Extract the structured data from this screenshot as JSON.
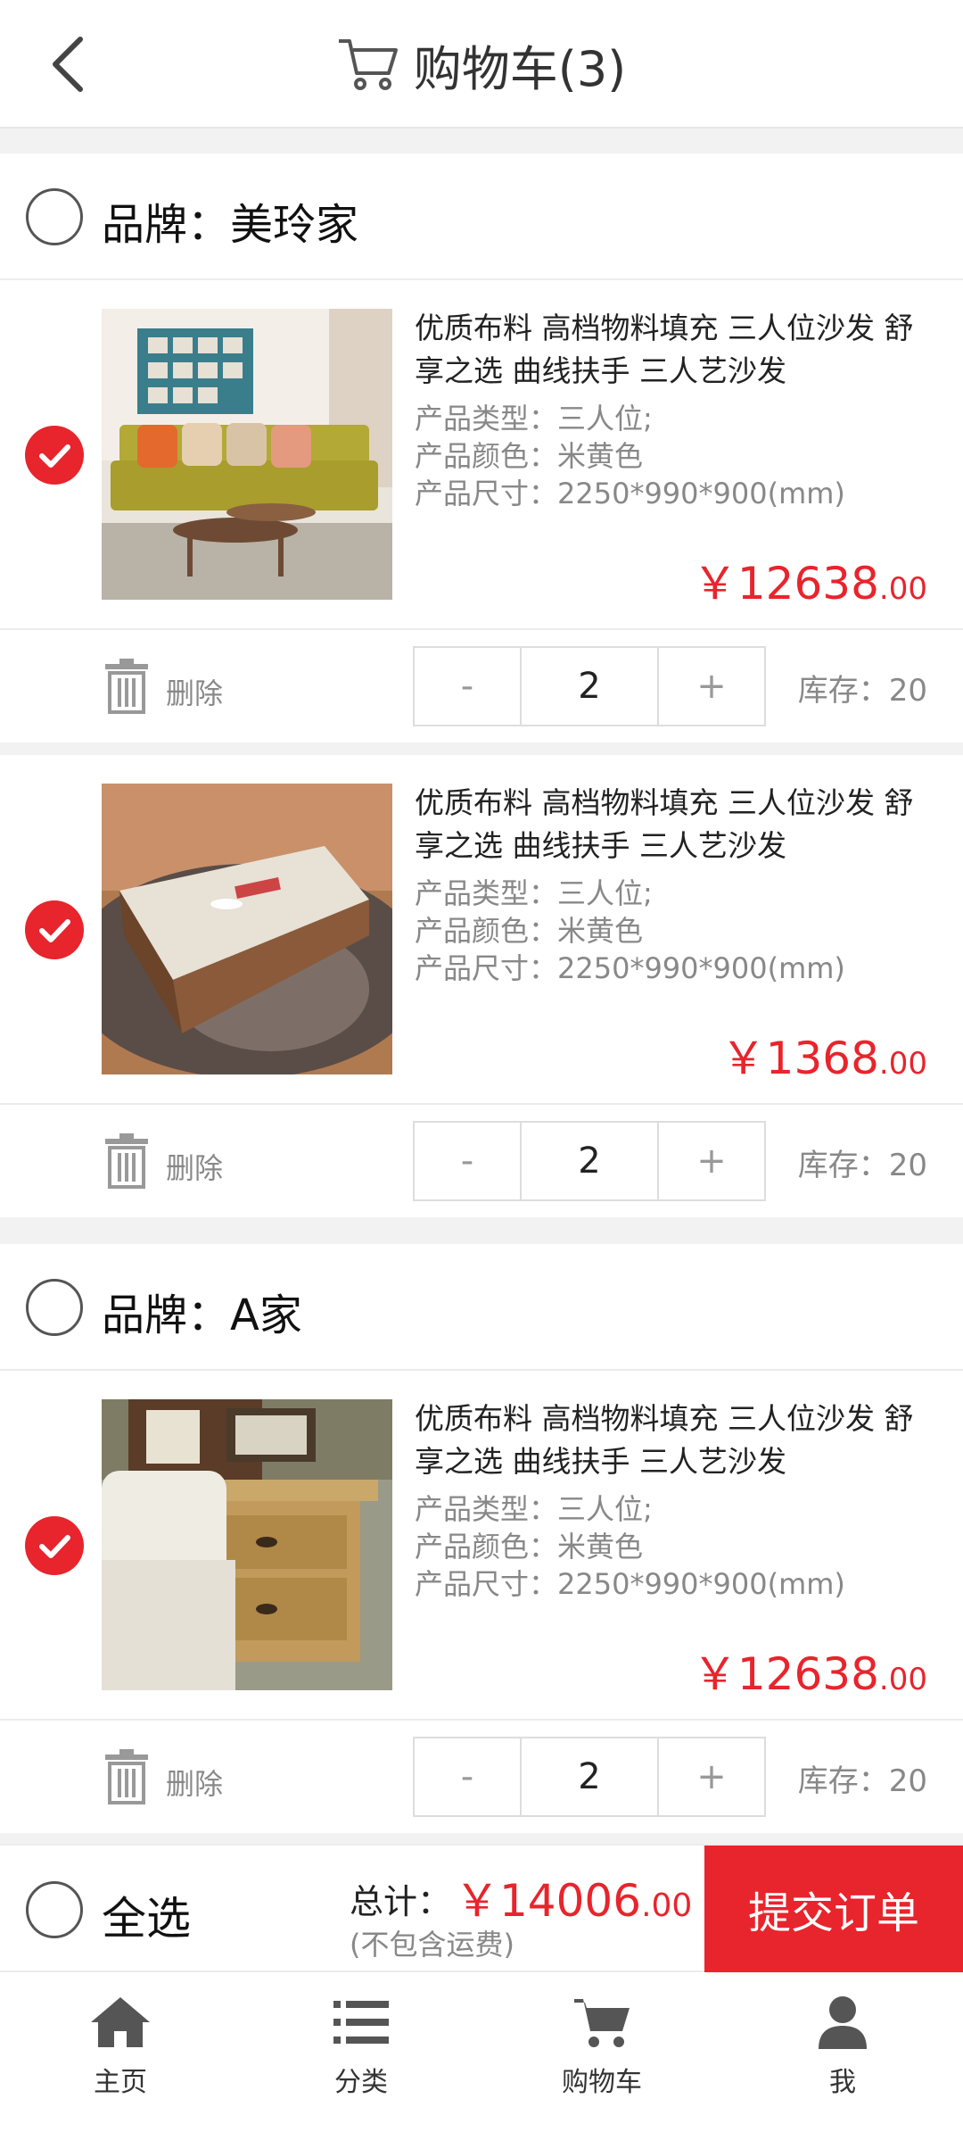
{
  "header": {
    "title": "购物车(3)"
  },
  "brands": [
    {
      "label": "品牌：美玲家",
      "items": [
        {
          "name": "优质布料 高档物料填充 三人位沙发 舒享之选 曲线扶手 三人艺沙发",
          "type": "产品类型：三人位;",
          "color": "产品颜色：米黄色",
          "size": "产品尺寸：2250*990*900(mm)",
          "price_int": "￥12638",
          "price_dec": ".00",
          "delete_label": "删除",
          "minus": "-",
          "qty": "2",
          "plus": "+",
          "stock": "库存：20"
        },
        {
          "name": "优质布料 高档物料填充 三人位沙发 舒享之选 曲线扶手 三人艺沙发",
          "type": "产品类型：三人位;",
          "color": "产品颜色：米黄色",
          "size": "产品尺寸：2250*990*900(mm)",
          "price_int": "￥1368",
          "price_dec": ".00",
          "delete_label": "删除",
          "minus": "-",
          "qty": "2",
          "plus": "+",
          "stock": "库存：20"
        }
      ]
    },
    {
      "label": "品牌：A家",
      "items": [
        {
          "name": "优质布料 高档物料填充 三人位沙发 舒享之选 曲线扶手 三人艺沙发",
          "type": "产品类型：三人位;",
          "color": "产品颜色：米黄色",
          "size": "产品尺寸：2250*990*900(mm)",
          "price_int": "￥12638",
          "price_dec": ".00",
          "delete_label": "删除",
          "minus": "-",
          "qty": "2",
          "plus": "+",
          "stock": "库存：20"
        }
      ]
    }
  ],
  "footer": {
    "select_all": "全选",
    "total_label": "总计：",
    "total_int": "￥14006",
    "total_dec": ".00",
    "shipping_note": "(不包含运费)",
    "submit": "提交订单"
  },
  "tabbar": [
    {
      "label": "主页",
      "icon": "home-icon"
    },
    {
      "label": "分类",
      "icon": "list-icon"
    },
    {
      "label": "购物车",
      "icon": "cart-icon"
    },
    {
      "label": "我",
      "icon": "user-icon"
    }
  ],
  "colors": {
    "accent": "#e8242c",
    "divider": "#f2f2f2",
    "muted": "#888888"
  }
}
